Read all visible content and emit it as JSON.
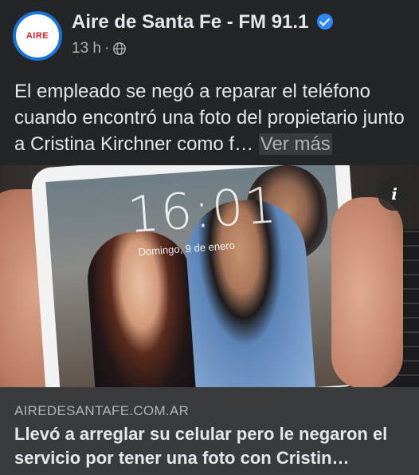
{
  "header": {
    "avatar_text": "AIRE",
    "page_name": "Aire de Santa Fe - FM 91.1",
    "time_ago": "13 h",
    "separator": "·"
  },
  "post": {
    "text": "El empleado se negó a reparar el teléfono cuando encontró una foto del propietario junto a Cristina Kirchner como f…",
    "see_more": "Ver más"
  },
  "image": {
    "lock_time": "16:01",
    "lock_date": "Domingo, 9 de enero",
    "info_icon": "i"
  },
  "link": {
    "domain": "AIREDESANTAFE.COM.AR",
    "title": "Llevó a arreglar su celular pero le negaron el servicio por tener una foto con Cristin…"
  },
  "colors": {
    "background": "#242526",
    "link_background": "#3a3b3c",
    "verified": "#2d88ff",
    "avatar_ring": "#1a73d9",
    "logo": "#d81f26"
  },
  "icons": [
    "verified-badge-icon",
    "globe-icon",
    "info-icon"
  ]
}
